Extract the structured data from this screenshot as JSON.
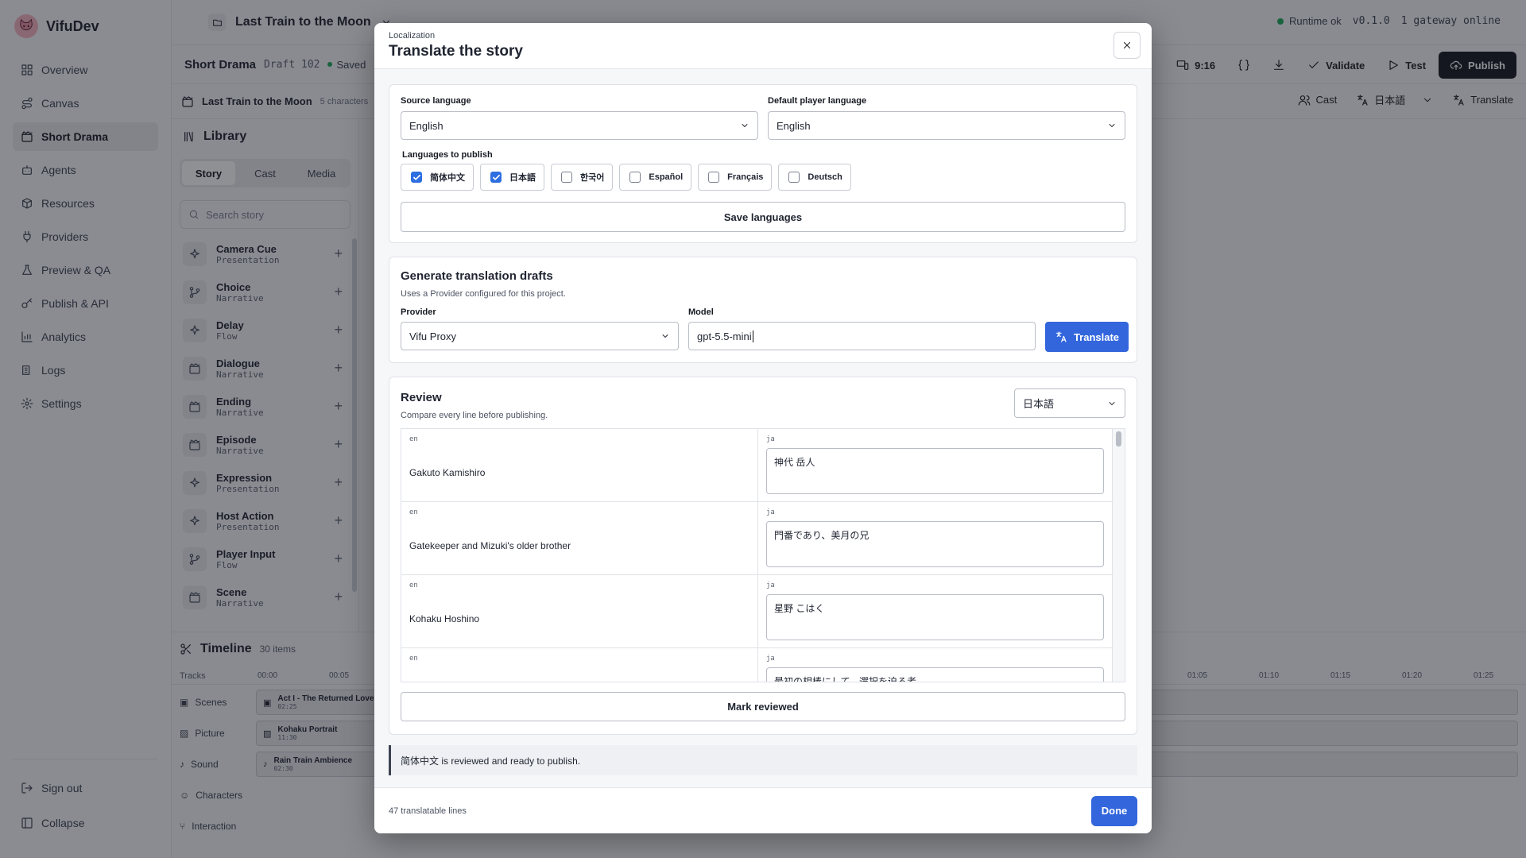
{
  "app": {
    "name": "VifuDev"
  },
  "sidebar": {
    "items": [
      {
        "label": "Overview",
        "icon": "grid-icon"
      },
      {
        "label": "Canvas",
        "icon": "route-icon"
      },
      {
        "label": "Short Drama",
        "icon": "clapper-icon",
        "active": true
      },
      {
        "label": "Agents",
        "icon": "bot-icon"
      },
      {
        "label": "Resources",
        "icon": "boxes-icon"
      },
      {
        "label": "Providers",
        "icon": "plug-icon"
      },
      {
        "label": "Preview & QA",
        "icon": "flask-icon"
      },
      {
        "label": "Publish & API",
        "icon": "key-icon"
      },
      {
        "label": "Analytics",
        "icon": "chart-icon"
      },
      {
        "label": "Logs",
        "icon": "logs-icon"
      },
      {
        "label": "Settings",
        "icon": "gear-icon"
      }
    ],
    "sign_out": "Sign out",
    "collapse": "Collapse"
  },
  "topbar": {
    "project": "Last Train to the Moon",
    "runtime_status": "Runtime ok",
    "version": "v0.1.0",
    "gateway": "1 gateway online"
  },
  "draftbar": {
    "title": "Short Drama",
    "draft": "Draft 102",
    "saved": "Saved",
    "ratio": "9:16",
    "validate": "Validate",
    "test": "Test",
    "publish": "Publish"
  },
  "storybar": {
    "title": "Last Train to the Moon",
    "characters": "5 characters",
    "cast": "Cast",
    "language": "日本語",
    "translate": "Translate"
  },
  "library": {
    "title": "Library",
    "tabs": [
      "Story",
      "Cast",
      "Media"
    ],
    "search_placeholder": "Search story",
    "items": [
      {
        "name": "Camera Cue",
        "kind": "Presentation",
        "icon": "sparkles-icon"
      },
      {
        "name": "Choice",
        "kind": "Narrative",
        "icon": "branch-icon"
      },
      {
        "name": "Delay",
        "kind": "Flow",
        "icon": "sparkles-icon"
      },
      {
        "name": "Dialogue",
        "kind": "Narrative",
        "icon": "clapper-icon"
      },
      {
        "name": "Ending",
        "kind": "Narrative",
        "icon": "clapper-icon"
      },
      {
        "name": "Episode",
        "kind": "Narrative",
        "icon": "clapper-icon"
      },
      {
        "name": "Expression",
        "kind": "Presentation",
        "icon": "sparkles-icon"
      },
      {
        "name": "Host Action",
        "kind": "Presentation",
        "icon": "sparkles-icon"
      },
      {
        "name": "Player Input",
        "kind": "Flow",
        "icon": "branch-icon"
      },
      {
        "name": "Scene",
        "kind": "Narrative",
        "icon": "clapper-icon"
      }
    ]
  },
  "timeline": {
    "title": "Timeline",
    "count": "30 items",
    "tracks_label": "Tracks",
    "ruler_left": [
      "00:00",
      "00:05"
    ],
    "ruler_right": [
      "01:05",
      "01:10",
      "01:15",
      "01:20",
      "01:25"
    ],
    "tracks": [
      {
        "name": "Scenes",
        "clip": "Act I - The Returned Love",
        "dur": "02:25"
      },
      {
        "name": "Picture",
        "clip": "Kohaku Portrait",
        "dur": "11:30"
      },
      {
        "name": "Sound",
        "clip": "Rain Train Ambience",
        "dur": "02:30"
      },
      {
        "name": "Characters"
      },
      {
        "name": "Interaction"
      }
    ]
  },
  "modal": {
    "kicker": "Localization",
    "title": "Translate the story",
    "source_label": "Source language",
    "source_value": "English",
    "default_label": "Default player language",
    "default_value": "English",
    "publish_label": "Languages to publish",
    "languages": [
      {
        "label": "简体中文",
        "checked": true
      },
      {
        "label": "日本語",
        "checked": true
      },
      {
        "label": "한국어",
        "checked": false
      },
      {
        "label": "Español",
        "checked": false
      },
      {
        "label": "Français",
        "checked": false
      },
      {
        "label": "Deutsch",
        "checked": false
      }
    ],
    "save_languages": "Save languages",
    "gen_title": "Generate translation drafts",
    "gen_sub": "Uses a Provider configured for this project.",
    "provider_label": "Provider",
    "provider_value": "Vifu Proxy",
    "model_label": "Model",
    "model_value": "gpt-5.5-mini",
    "translate_button": "Translate",
    "review_title": "Review",
    "review_sub": "Compare every line before publishing.",
    "review_lang": "日本語",
    "rows": [
      {
        "src_lang": "en",
        "src": "Gakuto Kamishiro",
        "tgt_lang": "ja",
        "tgt": "神代 岳人"
      },
      {
        "src_lang": "en",
        "src": "Gatekeeper and Mizuki's older brother",
        "tgt_lang": "ja",
        "tgt": "門番であり、美月の兄"
      },
      {
        "src_lang": "en",
        "src": "Kohaku Hoshino",
        "tgt_lang": "ja",
        "tgt": "星野 こはく"
      },
      {
        "src_lang": "en",
        "src": "",
        "tgt_lang": "ja",
        "tgt": "最初の相棒にして、選択を迫る者"
      }
    ],
    "mark_reviewed": "Mark reviewed",
    "notice": "简体中文 is reviewed and ready to publish.",
    "footer_count": "47 translatable lines",
    "done": "Done"
  }
}
